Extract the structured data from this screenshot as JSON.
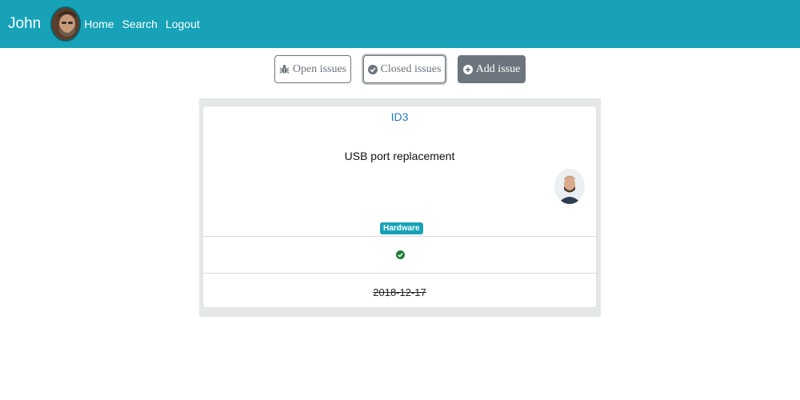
{
  "navbar": {
    "brand": "John",
    "links": {
      "home": "Home",
      "search": "Search",
      "logout": "Logout"
    },
    "background": "#17a2b8"
  },
  "toolbar": {
    "open_issues": "Open issues",
    "closed_issues": "Closed issues",
    "add_issue": "Add issue"
  },
  "issue": {
    "id": "ID3",
    "title": "USB port replacement",
    "category": "Hardware",
    "status": "closed",
    "date": "2018-12-17"
  },
  "colors": {
    "accent": "#17a2b8",
    "secondary": "#6c757d",
    "success": "#1e7e34",
    "link": "#1e7bbd"
  }
}
